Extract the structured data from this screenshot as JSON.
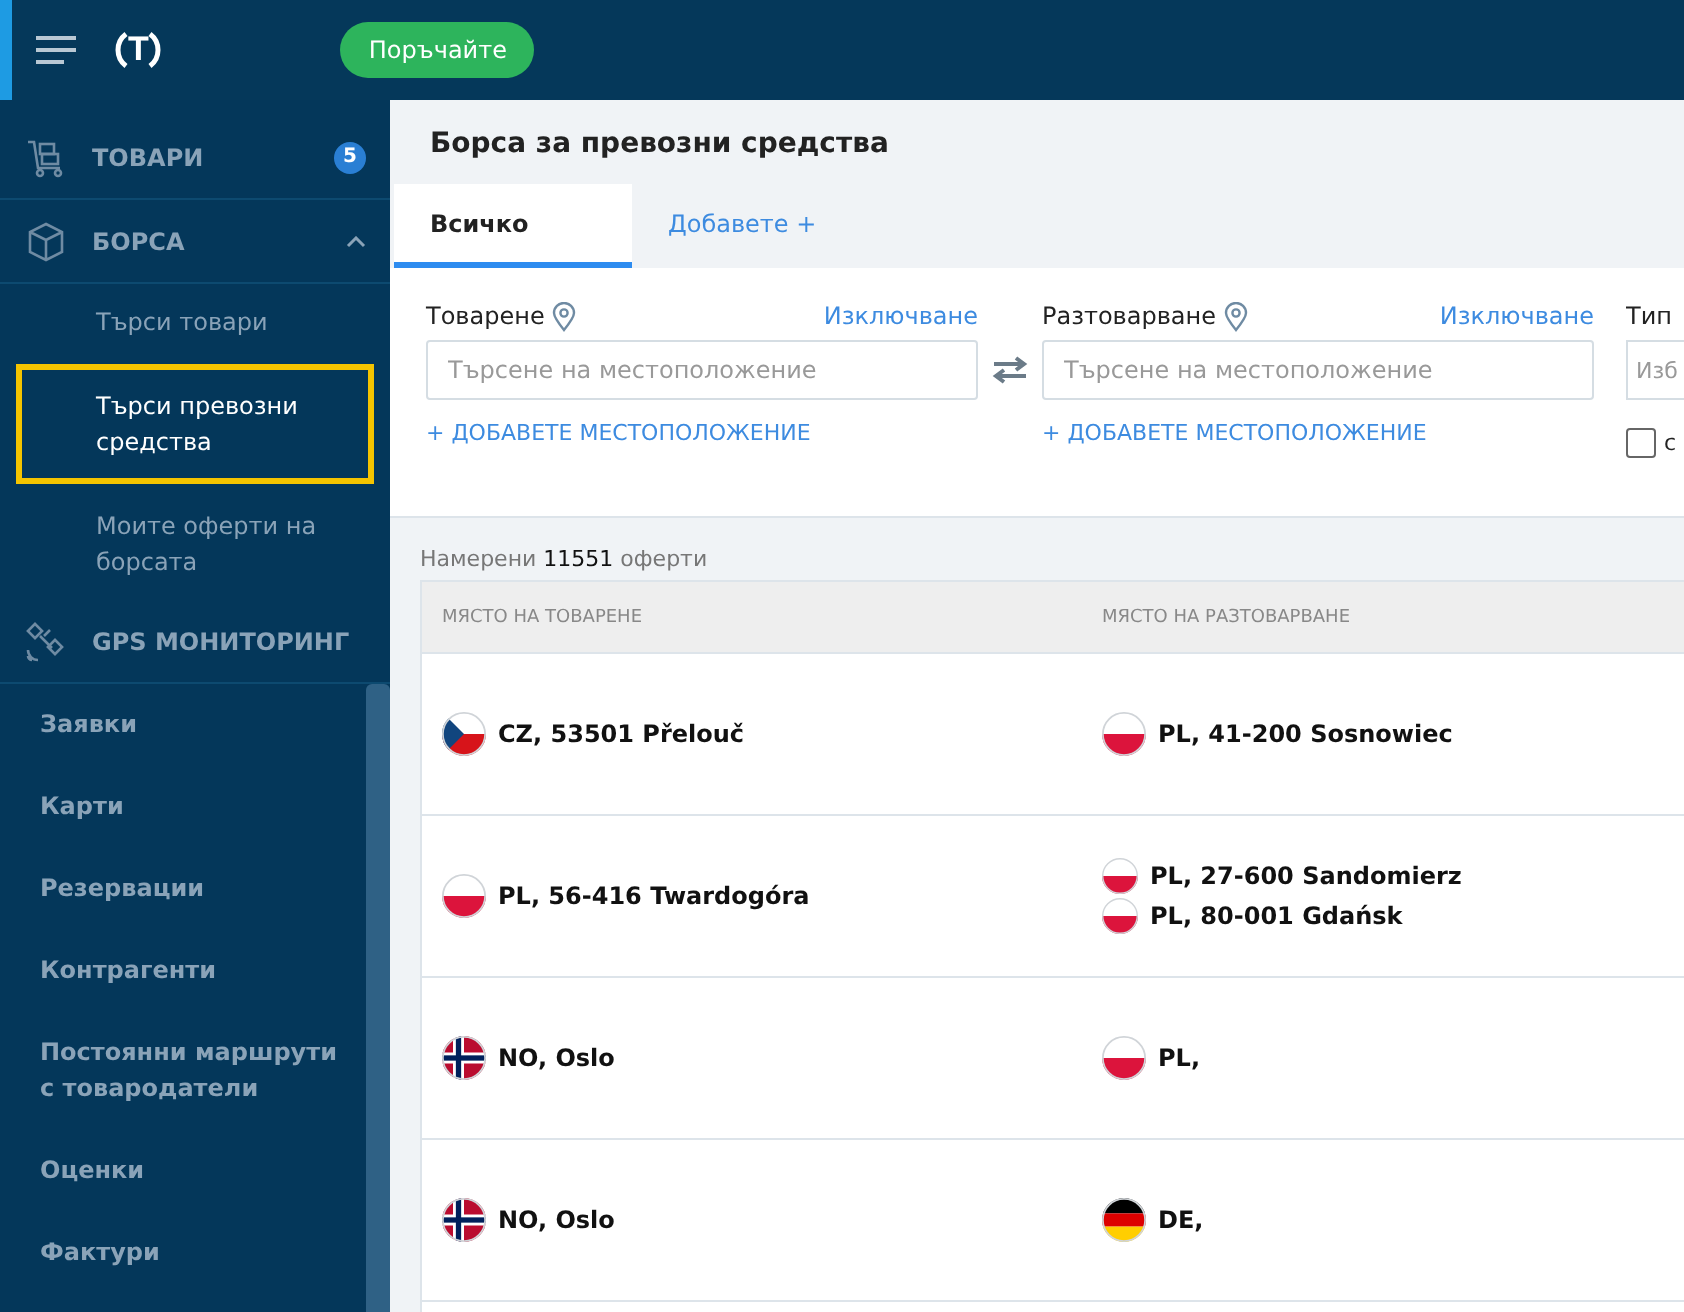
{
  "header": {
    "logo": "T",
    "order_button": "Поръчайте"
  },
  "sidebar": {
    "items": [
      {
        "kind": "section",
        "label": "ТОВАРИ",
        "badge": "5"
      },
      {
        "kind": "section",
        "label": "БОРСА",
        "expanded": true,
        "children": [
          {
            "label": "Търси товари",
            "selected": false
          },
          {
            "label": "Търси превозни средства",
            "selected": true
          },
          {
            "label": "Моите оферти на борсата",
            "selected": false
          }
        ]
      },
      {
        "kind": "section",
        "label": "GPS МОНИТОРИНГ"
      },
      {
        "kind": "plain",
        "label": "Заявки"
      },
      {
        "kind": "plain",
        "label": "Карти"
      },
      {
        "kind": "plain",
        "label": "Резервации"
      },
      {
        "kind": "plain",
        "label": "Контрагенти"
      },
      {
        "kind": "plain",
        "label": "Постоянни маршрути с товародатели"
      },
      {
        "kind": "plain",
        "label": "Оценки"
      },
      {
        "kind": "plain",
        "label": "Фактури"
      }
    ]
  },
  "page_title": "Борса за превозни средства",
  "tabs": [
    {
      "label": "Всичко",
      "selected": true
    },
    {
      "label": "Добавете +",
      "selected": false
    }
  ],
  "filters": [
    {
      "label": "Товарене",
      "exclude": "Изключване",
      "placeholder": "Търсене на местоположение",
      "add": "+ ДОБАВЕТЕ МЕСТОПОЛОЖЕНИЕ"
    },
    {
      "label": "Разтоварване",
      "exclude": "Изключване",
      "placeholder": "Търсене на местоположение",
      "add": "+ ДОБАВЕТЕ МЕСТОПОЛОЖЕНИЕ"
    }
  ],
  "filter_cut": {
    "label": "Тип",
    "placeholder": "Изб",
    "checkbox_label": "с",
    "checked": false
  },
  "results": {
    "prefix": "Намерени",
    "count": "11551",
    "suffix": "оферти"
  },
  "table": {
    "columns": [
      "МЯСТО НА ТОВАРЕНЕ",
      "МЯСТО НА РАЗТОВАРВАНЕ"
    ],
    "rows": [
      {
        "loading": {
          "kind": "czech",
          "text": "CZ, 53501 Přelouč"
        },
        "unloading": [
          {
            "kind": "polish",
            "text": "PL, 41-200 Sosnowiec"
          }
        ]
      },
      {
        "loading": {
          "kind": "polish",
          "text": "PL, 56-416 Twardogóra"
        },
        "unloading": [
          {
            "kind": "polish",
            "text": "PL, 27-600 Sandomierz"
          },
          {
            "kind": "polish",
            "text": "PL, 80-001 Gdańsk"
          }
        ]
      },
      {
        "loading": {
          "kind": "norwegian",
          "text": "NO, Oslo"
        },
        "unloading": [
          {
            "kind": "polish",
            "text": "PL,"
          }
        ]
      },
      {
        "loading": {
          "kind": "norwegian",
          "text": "NO, Oslo"
        },
        "unloading": [
          {
            "kind": "german",
            "text": "DE,"
          }
        ]
      }
    ]
  }
}
